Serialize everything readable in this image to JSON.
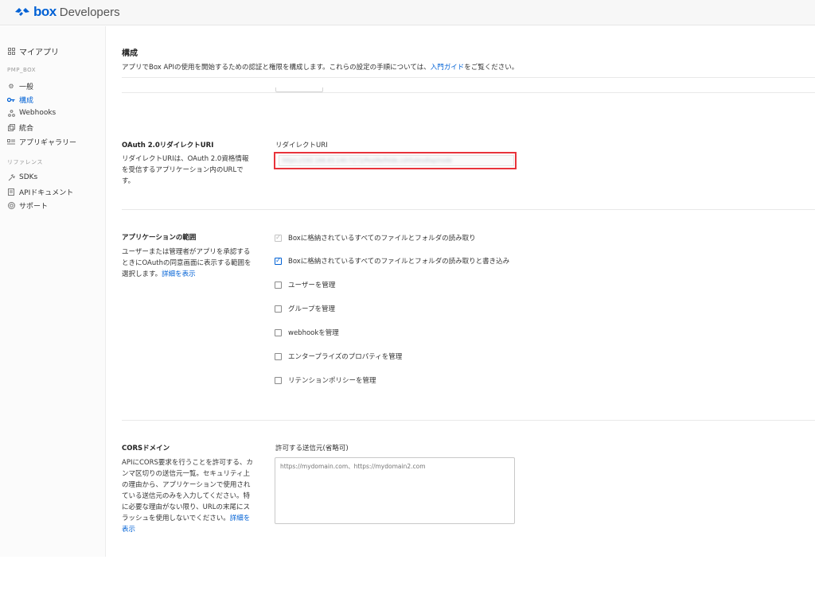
{
  "header": {
    "logo_box": "box",
    "logo_developers": "Developers",
    "brand_color": "#0061d5"
  },
  "sidebar": {
    "my_apps": "マイアプリ",
    "app_heading": "PMP_BOX",
    "items": [
      {
        "label": "一般",
        "icon": "gear-icon"
      },
      {
        "label": "構成",
        "icon": "key-icon",
        "active": true
      },
      {
        "label": "Webhooks",
        "icon": "webhook-icon"
      },
      {
        "label": "統合",
        "icon": "integration-icon"
      },
      {
        "label": "アプリギャラリー",
        "icon": "gallery-icon"
      }
    ],
    "reference_heading": "リファレンス",
    "reference_items": [
      {
        "label": "SDKs",
        "icon": "sdk-icon"
      },
      {
        "label": "APIドキュメント",
        "icon": "document-icon"
      },
      {
        "label": "サポート",
        "icon": "support-icon"
      }
    ]
  },
  "main": {
    "title": "構成",
    "description_prefix": "アプリでBox APIの使用を開始するための認証と権限を構成します。これらの設定の手順については、",
    "description_link": "入門ガイド",
    "description_suffix": "をご覧ください。",
    "oauth": {
      "title": "OAuth 2.0リダイレクトURI",
      "description": "リダイレクトURIは、OAuth 2.0資格情報を受信するアプリケーション内のURLです。",
      "field_label": "リダイレクトURI",
      "value": "https://192.168.83.140:7272/PestRefHide.cshSalesdlap/node"
    },
    "scopes": {
      "title": "アプリケーションの範囲",
      "description": "ユーザーまたは管理者がアプリを承認するときにOAuthの同意画面に表示する範囲を選択します。",
      "detail_link": "詳細を表示",
      "options": [
        {
          "label": "Boxに格納されているすべてのファイルとフォルダの読み取り",
          "checked": true,
          "disabled": true
        },
        {
          "label": "Boxに格納されているすべてのファイルとフォルダの読み取りと書き込み",
          "checked": true,
          "disabled": false
        },
        {
          "label": "ユーザーを管理",
          "checked": false,
          "disabled": false
        },
        {
          "label": "グループを管理",
          "checked": false,
          "disabled": false
        },
        {
          "label": "webhookを管理",
          "checked": false,
          "disabled": false
        },
        {
          "label": "エンタープライズのプロパティを管理",
          "checked": false,
          "disabled": false
        },
        {
          "label": "リテンションポリシーを管理",
          "checked": false,
          "disabled": false
        }
      ]
    },
    "cors": {
      "title": "CORSドメイン",
      "description": "APIにCORS要求を行うことを許可する、カンマ区切りの送信元一覧。セキュリティ上の理由から、アプリケーションで使用されている送信元のみを入力してください。特に必要な理由がない限り、URLの末尾にスラッシュを使用しないでください。",
      "detail_link": "詳細を表示",
      "field_label": "許可する送信元(省略可)",
      "placeholder": "https://mydomain.com、https://mydomain2.com"
    }
  }
}
